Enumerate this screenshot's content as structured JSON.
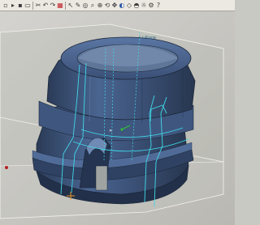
{
  "toolbar": {
    "items": [
      {
        "icon": "new-file-icon",
        "glyph": "▫"
      },
      {
        "icon": "open-icon",
        "glyph": "▸"
      },
      {
        "icon": "save-icon",
        "glyph": "▪"
      },
      {
        "icon": "print-icon",
        "glyph": "▭"
      },
      {
        "icon": "cut-icon",
        "glyph": "✂"
      },
      {
        "icon": "undo-icon",
        "glyph": "↶"
      },
      {
        "icon": "redo-icon",
        "glyph": "↷"
      },
      {
        "icon": "rebuild-icon",
        "glyph": "▦"
      },
      {
        "icon": "select-icon",
        "glyph": "↖"
      },
      {
        "icon": "sketch-icon",
        "glyph": "✎"
      },
      {
        "icon": "view-orient-icon",
        "glyph": "◎"
      },
      {
        "icon": "zoom-fit-icon",
        "glyph": "⌕"
      },
      {
        "icon": "zoom-area-icon",
        "glyph": "⊕"
      },
      {
        "icon": "rotate-icon",
        "glyph": "⟲"
      },
      {
        "icon": "pan-icon",
        "glyph": "✥"
      },
      {
        "icon": "shaded-icon",
        "glyph": "◐"
      },
      {
        "icon": "wireframe-icon",
        "glyph": "◇"
      },
      {
        "icon": "section-view-icon",
        "glyph": "◓"
      },
      {
        "icon": "lights-icon",
        "glyph": "☼"
      },
      {
        "icon": "options-icon",
        "glyph": "⚙"
      },
      {
        "icon": "help-icon",
        "glyph": "?"
      }
    ]
  },
  "viewport": {
    "plane_label": "(-) Plane",
    "colors": {
      "background": "#c9c9c4",
      "part_body": "#3e5477",
      "part_highlight": "#5c77a1",
      "sketch_lines": "#40d8e8",
      "plane_edges": "#f4f4ec"
    }
  }
}
